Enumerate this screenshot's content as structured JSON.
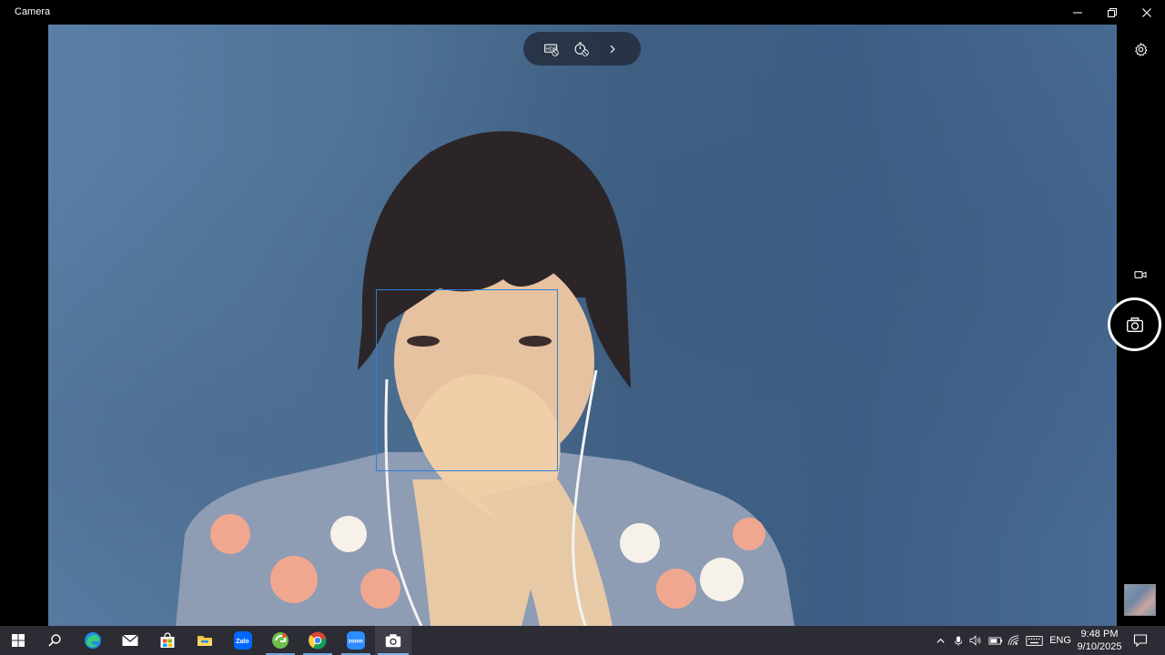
{
  "window": {
    "title": "Camera",
    "controls": {
      "minimize": "minimize-icon",
      "restore": "restore-icon",
      "close": "close-icon"
    }
  },
  "toolbar": {
    "items": [
      {
        "name": "hdr-off-icon"
      },
      {
        "name": "timer-off-icon"
      },
      {
        "name": "chevron-right-icon"
      }
    ]
  },
  "right_panel": {
    "settings": "gear-icon",
    "video_mode": "video-camera-icon",
    "photo_capture": "camera-icon",
    "last_capture_thumbnail": "thumbnail"
  },
  "face_detection": {
    "color": "#2f7fd6"
  },
  "taskbar": {
    "apps": [
      {
        "name": "start",
        "icon": "windows-icon"
      },
      {
        "name": "search",
        "icon": "search-icon"
      },
      {
        "name": "edge",
        "icon": "edge-icon"
      },
      {
        "name": "mail",
        "icon": "mail-icon"
      },
      {
        "name": "store",
        "icon": "store-icon"
      },
      {
        "name": "file-explorer",
        "icon": "folder-icon"
      },
      {
        "name": "zalo",
        "icon": "zalo-icon",
        "label": "Zalo"
      },
      {
        "name": "greenshot",
        "icon": "greenshot-icon"
      },
      {
        "name": "chrome",
        "icon": "chrome-icon"
      },
      {
        "name": "zoom",
        "icon": "zoom-icon",
        "label": "zoom"
      },
      {
        "name": "camera",
        "icon": "camera-icon"
      }
    ],
    "tray": {
      "language": "ENG",
      "time": "9:48 PM",
      "date": "9/10/2025"
    }
  },
  "colors": {
    "accent": "#2f7fd6",
    "taskbar": "#2b2c34",
    "titlebar": "#000000"
  }
}
